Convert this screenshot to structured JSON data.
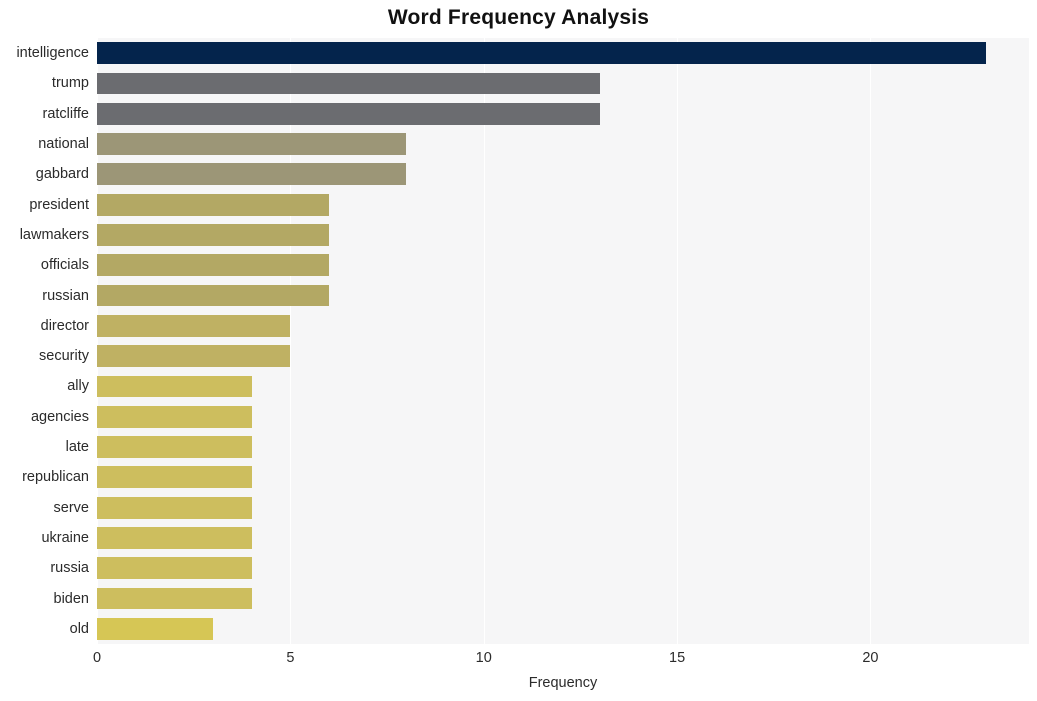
{
  "chart_data": {
    "type": "bar",
    "orientation": "horizontal",
    "title": "Word Frequency Analysis",
    "xlabel": "Frequency",
    "ylabel": "",
    "xlim": [
      0,
      24.1
    ],
    "ylim": [
      0,
      20
    ],
    "grid": "vertical-only",
    "legend": "none",
    "xticks": [
      "0",
      "5",
      "10",
      "15",
      "20"
    ],
    "xtick_values": [
      0,
      5,
      10,
      15,
      20
    ],
    "categories": [
      "intelligence",
      "trump",
      "ratcliffe",
      "national",
      "gabbard",
      "president",
      "lawmakers",
      "officials",
      "russian",
      "director",
      "security",
      "ally",
      "agencies",
      "late",
      "republican",
      "serve",
      "ukraine",
      "russia",
      "biden",
      "old"
    ],
    "values": [
      23,
      13,
      13,
      8,
      8,
      6,
      6,
      6,
      6,
      5,
      5,
      4,
      4,
      4,
      4,
      4,
      4,
      4,
      4,
      3
    ],
    "bar_colors": [
      "#04244c",
      "#6b6c70",
      "#6b6c70",
      "#9c9677",
      "#9c9677",
      "#b3a864",
      "#b3a864",
      "#b3a864",
      "#b3a864",
      "#bfb163",
      "#bfb163",
      "#cdbe5e",
      "#cdbe5e",
      "#cdbe5e",
      "#cdbe5e",
      "#cdbe5e",
      "#cdbe5e",
      "#cdbe5e",
      "#cdbe5e",
      "#d6c655"
    ]
  },
  "style": {
    "plot_background": "#f6f6f7",
    "gridline_color": "#ffffff",
    "page_background": "#ffffff",
    "text_color": "#2b2b2b",
    "title_color": "#111111"
  }
}
